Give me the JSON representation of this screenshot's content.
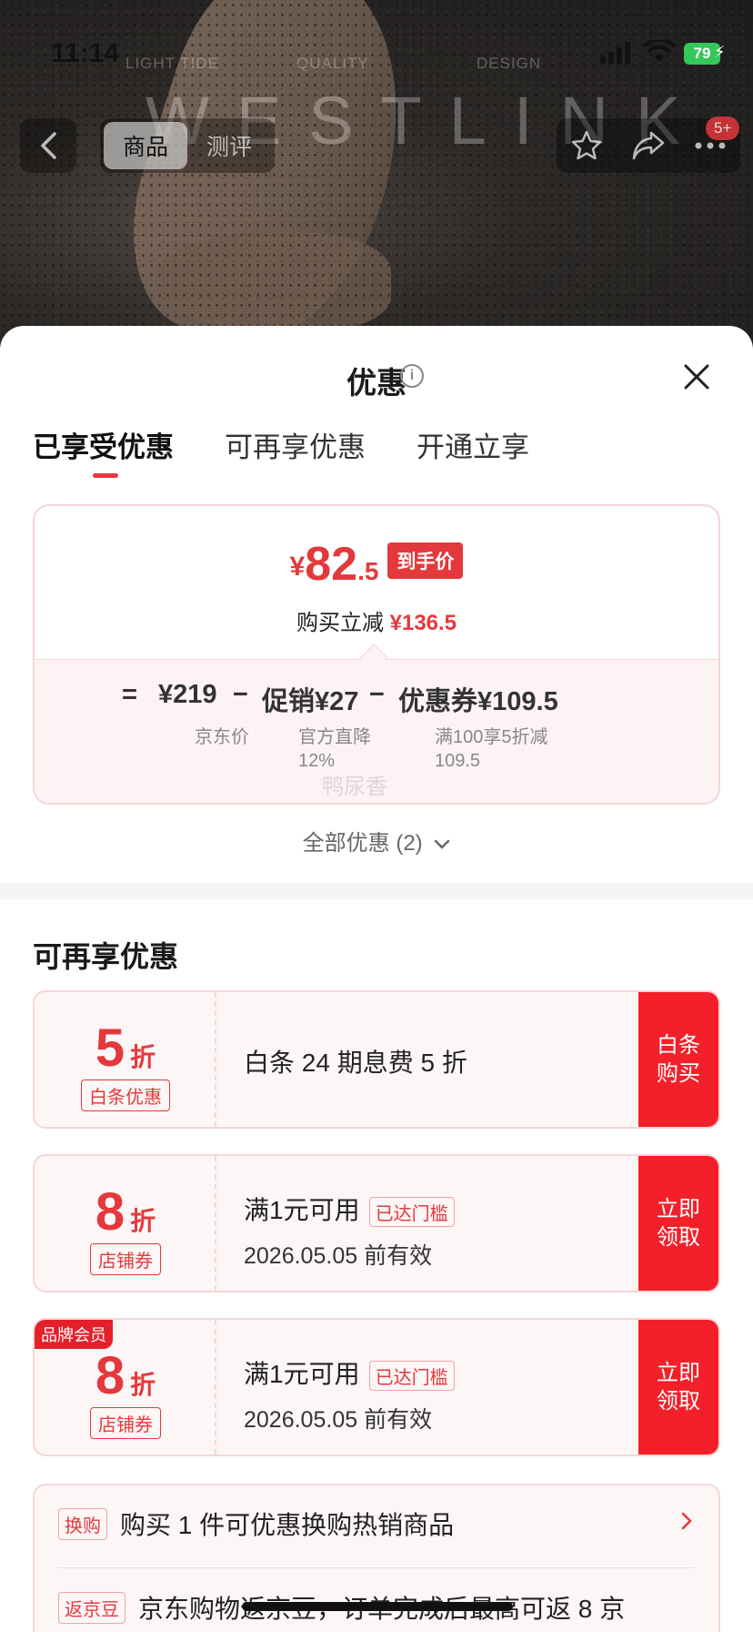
{
  "status_bar": {
    "time": "11:14",
    "battery": "79"
  },
  "background": {
    "brand_labels": [
      "LIGHT TIDE",
      "QUALITY",
      "DESIGN"
    ],
    "brand_name": "WESTLINK"
  },
  "top_nav": {
    "tabs": [
      "商品",
      "测评"
    ],
    "message_badge": "5+"
  },
  "sheet": {
    "title": "优惠",
    "tabs": [
      "已享受优惠",
      "可再享优惠",
      "开通立享"
    ],
    "summary": {
      "yen": "¥",
      "price_int": "82",
      "price_dec": ".5",
      "price_tag": "到手价",
      "reduce_label": "购买立减",
      "reduce_value": "¥136.5",
      "formula": {
        "eq": "=",
        "jd_price": "¥219",
        "minus1": "−",
        "promo": "促销¥27",
        "minus2": "−",
        "coupon": "优惠券¥109.5",
        "jd_price_label": "京东价",
        "promo_label_1": "官方直降",
        "promo_label_2": "12%",
        "coupon_label_1": "满100享5折减",
        "coupon_label_2": "109.5"
      },
      "watermark": "鸭尿香"
    },
    "all_offers": "全部优惠 (2)",
    "more_section_title": "可再享优惠",
    "coupons": [
      {
        "rate": "5",
        "unit": "折",
        "type": "白条优惠",
        "desc": "白条 24 期息费 5 折",
        "threshold": "",
        "date": "",
        "button": "白条购买",
        "member": ""
      },
      {
        "rate": "8",
        "unit": "折",
        "type": "店铺券",
        "desc": "满1元可用",
        "threshold": "已达门槛",
        "date": "2026.05.05 前有效",
        "button": "立即领取",
        "member": ""
      },
      {
        "rate": "8",
        "unit": "折",
        "type": "店铺券",
        "desc": "满1元可用",
        "threshold": "已达门槛",
        "date": "2026.05.05 前有效",
        "button": "立即领取",
        "member": "品牌会员"
      }
    ],
    "extras": [
      {
        "tag": "换购",
        "text": "购买 1 件可优惠换购热销商品"
      },
      {
        "tag": "返京豆",
        "text": "京东购物返京豆，订单完成后最高可返 8 京"
      }
    ]
  },
  "colors": {
    "accent": "#e4393c",
    "button_red": "#f3202a",
    "border_pink": "#f5d6d8"
  }
}
